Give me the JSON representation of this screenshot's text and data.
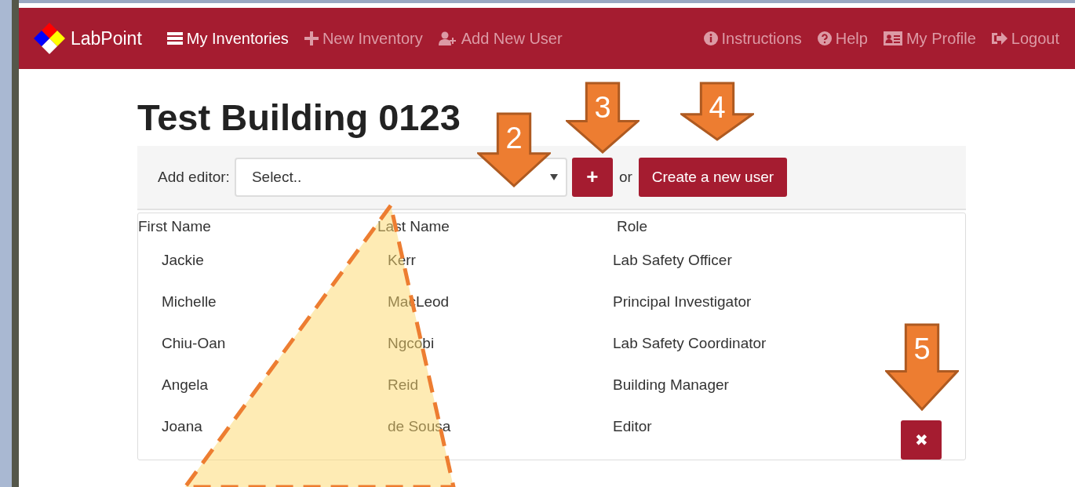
{
  "navbar": {
    "brand": "LabPoint",
    "left_items": [
      {
        "label": "My Inventories",
        "selected": true
      },
      {
        "label": "New Inventory",
        "selected": false
      },
      {
        "label": "Add New User",
        "selected": false
      }
    ],
    "right_items": [
      {
        "label": "Instructions"
      },
      {
        "label": "Help"
      },
      {
        "label": "My Profile"
      },
      {
        "label": "Logout"
      }
    ]
  },
  "page_title": "Test Building 0123",
  "editor_bar": {
    "label": "Add editor:",
    "select": {
      "placeholder": "Select.."
    },
    "add_button": "+",
    "or_text": "or",
    "create_button": "Create a new user"
  },
  "table": {
    "columns": [
      "First Name",
      "Last Name",
      "Role"
    ],
    "rows": [
      {
        "first": "Jackie",
        "last": "Kerr",
        "role": "Lab Safety Officer"
      },
      {
        "first": "Michelle",
        "last": "MacLeod",
        "role": "Principal Investigator"
      },
      {
        "first": "Chiu-Oan",
        "last": "Ngcobi",
        "role": "Lab Safety Coordinator"
      },
      {
        "first": "Angela",
        "last": "Reid",
        "role": "Building Manager"
      },
      {
        "first": "Joana",
        "last": "de Sousa",
        "role": "Editor",
        "remove_button": "✖"
      }
    ]
  },
  "annotations": [
    {
      "label": "2"
    },
    {
      "label": "3"
    },
    {
      "label": "4"
    },
    {
      "label": "5"
    }
  ]
}
